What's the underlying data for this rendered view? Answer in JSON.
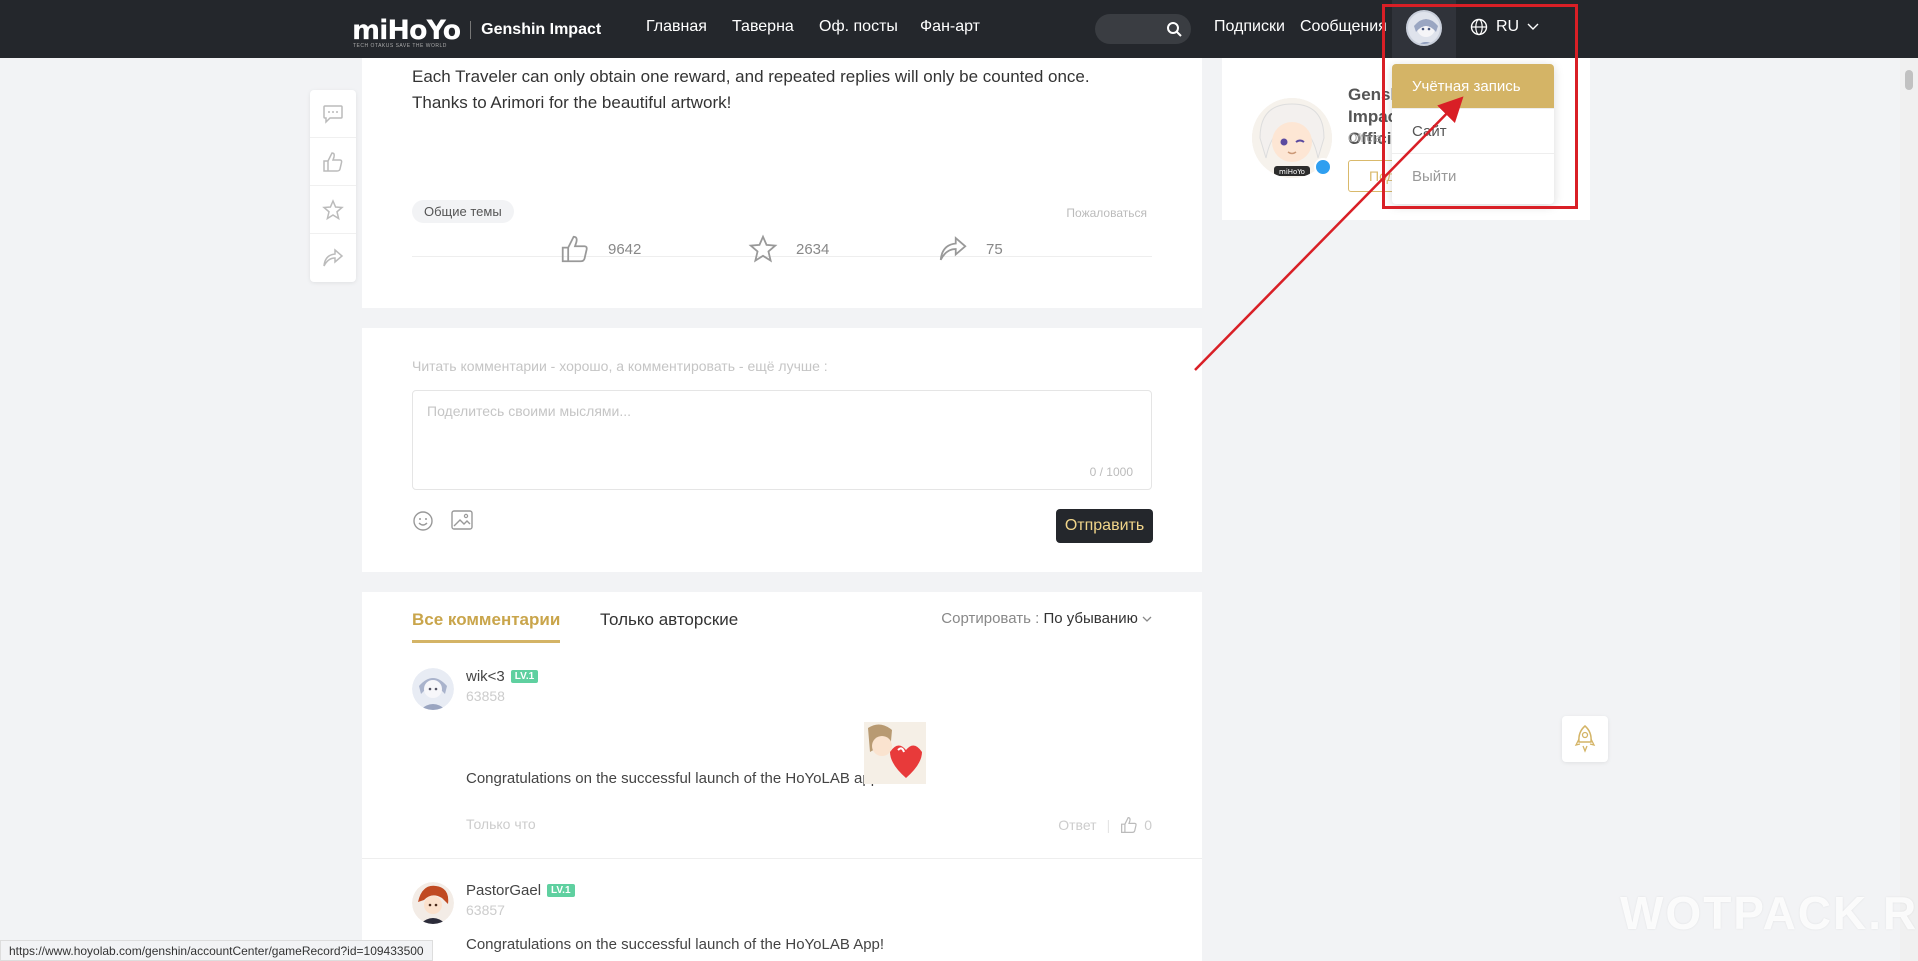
{
  "navbar": {
    "logo": "miHoYo",
    "logo_tagline": "TECH OTAKUS SAVE THE WORLD",
    "game": "Genshin Impact",
    "links": [
      "Главная",
      "Таверна",
      "Оф. посты",
      "Фан-арт"
    ],
    "subscriptions": "Подписки",
    "messages": "Сообщения",
    "language": "RU"
  },
  "post": {
    "line1": "Each Traveler can only obtain one reward, and repeated replies will only be counted once.",
    "line2": "Thanks to Arimori for the beautiful artwork!",
    "tag": "Общие темы",
    "report": "Пожаловаться",
    "likes": "9642",
    "favorites": "2634",
    "shares": "75"
  },
  "comment_form": {
    "prompt": "Читать комментарии - хорошо, а комментировать - ещё лучше :",
    "placeholder": "Поделитесь своими мыслями...",
    "counter": "0 / 1000",
    "send_label": "Отправить"
  },
  "comments_section": {
    "tab_all": "Все комментарии",
    "tab_author": "Только авторские",
    "sort_label": "Сортировать :",
    "sort_value": "По убыванию",
    "items": [
      {
        "user": "wik<3",
        "level": "LV.1",
        "id": "63858",
        "text": "Congratulations on the successful launch of the HoYoLAB app!",
        "time": "Только что",
        "reply": "Ответ",
        "likes": "0"
      },
      {
        "user": "PastorGael",
        "level": "LV.1",
        "id": "63857",
        "text": "Congratulations on the successful launch of the HoYoLAB App!"
      }
    ]
  },
  "profile": {
    "name": "Genshin Impact Official",
    "subtitle": "Official",
    "button": "Подписаться"
  },
  "dropdown": {
    "items": [
      "Учётная запись",
      "Сайт",
      "Выйти"
    ]
  },
  "status_url": "https://www.hoyolab.com/genshin/accountCenter/gameRecord?id=109433500",
  "watermark": "WOTPACK.RU",
  "colors": {
    "accent": "#d4b466",
    "navbar": "#24272c",
    "annotation": "#d91f26"
  }
}
